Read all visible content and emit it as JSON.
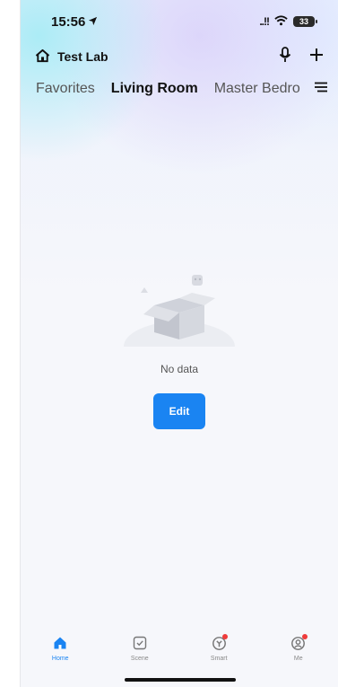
{
  "status_bar": {
    "time": "15:56",
    "signal": "..!!",
    "battery": "33"
  },
  "header": {
    "home_name": "Test Lab"
  },
  "tabs": [
    {
      "label": "Favorites",
      "active": false
    },
    {
      "label": "Living Room",
      "active": true
    },
    {
      "label": "Master Bedro",
      "active": false
    }
  ],
  "empty_state": {
    "message": "No data",
    "edit_label": "Edit"
  },
  "tabbar": [
    {
      "label": "Home",
      "icon": "home-icon",
      "active": true,
      "badge": false
    },
    {
      "label": "Scene",
      "icon": "scene-check-icon",
      "active": false,
      "badge": false
    },
    {
      "label": "Smart",
      "icon": "smart-icon",
      "active": false,
      "badge": true
    },
    {
      "label": "Me",
      "icon": "profile-icon",
      "active": false,
      "badge": true
    }
  ],
  "colors": {
    "accent": "#1a84f2",
    "badge": "#ef3b3b",
    "background": "#f6f7fb"
  }
}
